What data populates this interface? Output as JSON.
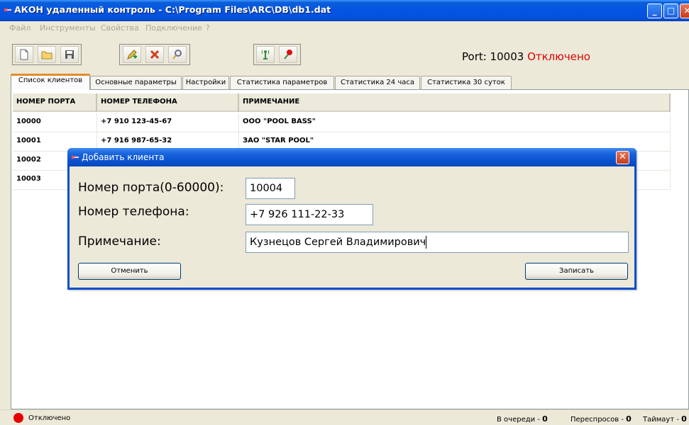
{
  "window": {
    "title": "АКОН удаленный контроль - C:\\Program Files\\ARC\\DB\\db1.dat",
    "min_glyph": "_",
    "max_glyph": "□",
    "close_glyph": "✕"
  },
  "menu": [
    "Файл",
    "Инструменты",
    "Свойства",
    "Подключение",
    "?"
  ],
  "toolbar": {
    "port_label": "Port: 10003",
    "connection_status": "Отключено",
    "colors": {
      "status_off": "#e00000"
    }
  },
  "tabs": [
    {
      "label": "Список клиентов",
      "active": true
    },
    {
      "label": "Основные параметры",
      "active": false
    },
    {
      "label": "Настройки",
      "active": false
    },
    {
      "label": "Статистика параметров",
      "active": false
    },
    {
      "label": "Статистика 24 часа",
      "active": false
    },
    {
      "label": "Статистика 30 суток",
      "active": false
    }
  ],
  "clients_table": {
    "columns": [
      "НОМЕР ПОРТА",
      "НОМЕР ТЕЛЕФОНА",
      "ПРИМЕЧАНИЕ"
    ],
    "rows": [
      [
        "10000",
        "+7 910 123-45-67",
        "ООО \"POOL BASS\""
      ],
      [
        "10001",
        "+7 916 987-65-32",
        "ЗАО \"STAR POOL\""
      ],
      [
        "10002",
        "",
        ""
      ],
      [
        "10003",
        "",
        ""
      ]
    ]
  },
  "dialog": {
    "title": "Добавить клиента",
    "port_label": "Номер порта(0-60000):",
    "port_value": "10004",
    "phone_label": "Номер телефона:",
    "phone_value": "+7 926 111-22-33",
    "note_label": "Примечание:",
    "note_value": "Кузнецов Сергей Владимирович",
    "cancel_label": "Отменить",
    "save_label": "Записать",
    "close_glyph": "✕"
  },
  "statusbar": {
    "connection": "Отключено",
    "queue_label": "В очереди - ",
    "queue_value": "0",
    "retries_label": "Переспросов - ",
    "retries_value": "0",
    "timeout_label": "Таймаут - ",
    "timeout_value": "0"
  }
}
